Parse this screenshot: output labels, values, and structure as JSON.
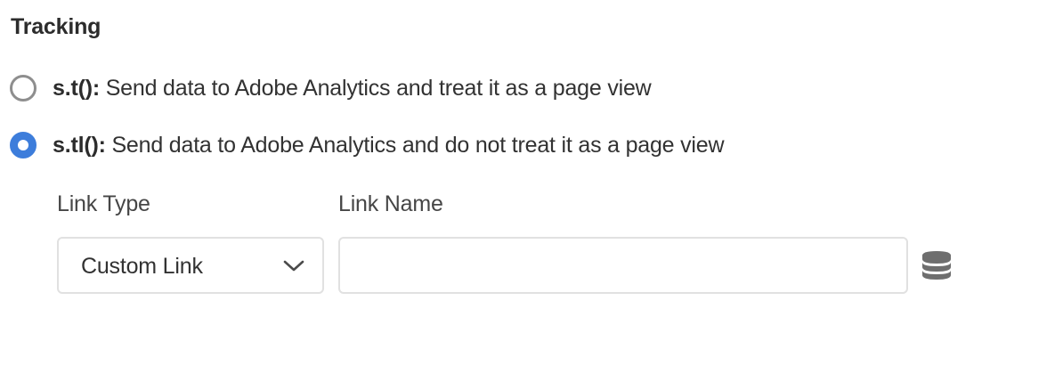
{
  "section": {
    "title": "Tracking"
  },
  "tracking_options": [
    {
      "code": "s.t():",
      "description": " Send data to Adobe Analytics and treat it as a page view",
      "selected": false
    },
    {
      "code": "s.tl():",
      "description": " Send data to Adobe Analytics and do not treat it as a page view",
      "selected": true
    }
  ],
  "link_type": {
    "label": "Link Type",
    "value": "Custom Link"
  },
  "link_name": {
    "label": "Link Name",
    "value": "",
    "placeholder": ""
  },
  "icons": {
    "dropdown": "chevron-down-icon",
    "data_element": "database-icon"
  },
  "colors": {
    "radio_selected": "#3d7ddb",
    "radio_unselected": "#8e8e8e",
    "field_border": "#e1e1e1",
    "icon": "#6e6e6e"
  }
}
